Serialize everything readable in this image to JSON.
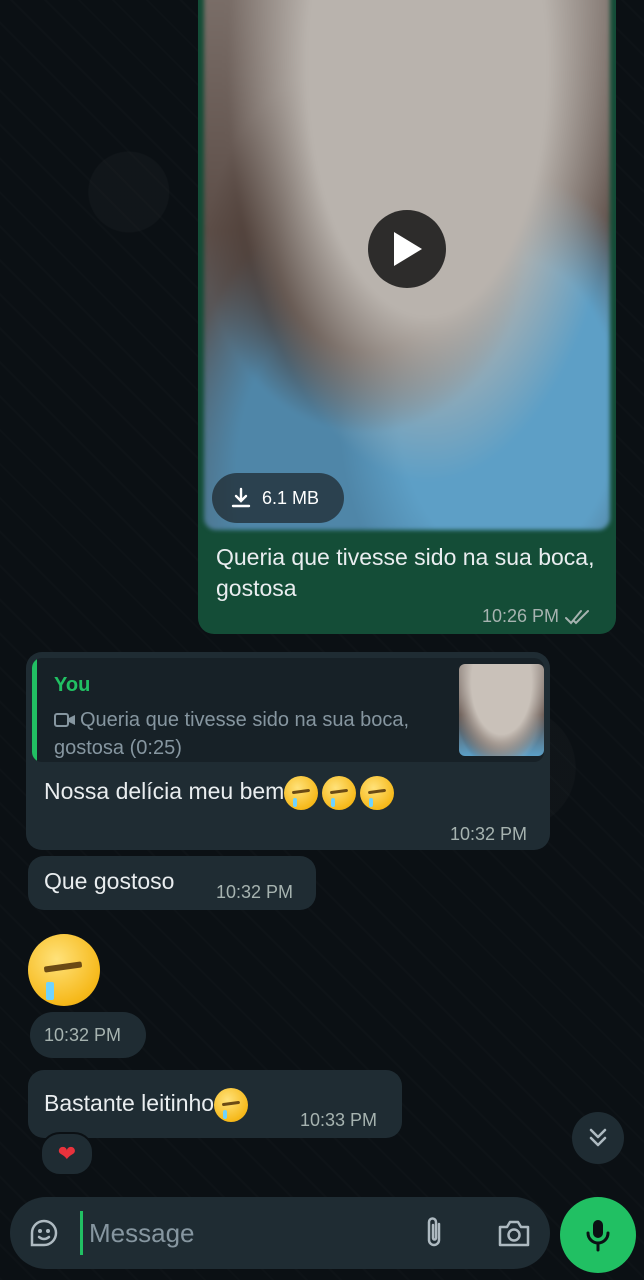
{
  "messages": {
    "video": {
      "file_size": "6.1 MB",
      "caption": "Queria que tivesse sido na sua boca, gostosa",
      "time": "10:26 PM",
      "status": "read"
    },
    "reply": {
      "quote_author": "You",
      "quote_text": "Queria que tivesse sido na sua boca, gostosa (0:25)",
      "text": "Nossa delícia meu bem",
      "emoji_count": 3,
      "time": "10:32 PM"
    },
    "que_gostoso": {
      "text": "Que gostoso",
      "time": "10:32 PM"
    },
    "emoji_only": {
      "emoji": "drooling-face",
      "time": "10:32 PM"
    },
    "bastante": {
      "text": "Bastante leitinho",
      "time": "10:33 PM",
      "reaction": "❤"
    }
  },
  "composer": {
    "placeholder": "Message"
  },
  "colors": {
    "outgoing": "#144d37",
    "incoming": "#1f2c33",
    "accent": "#21c063",
    "background": "#0b1014"
  }
}
